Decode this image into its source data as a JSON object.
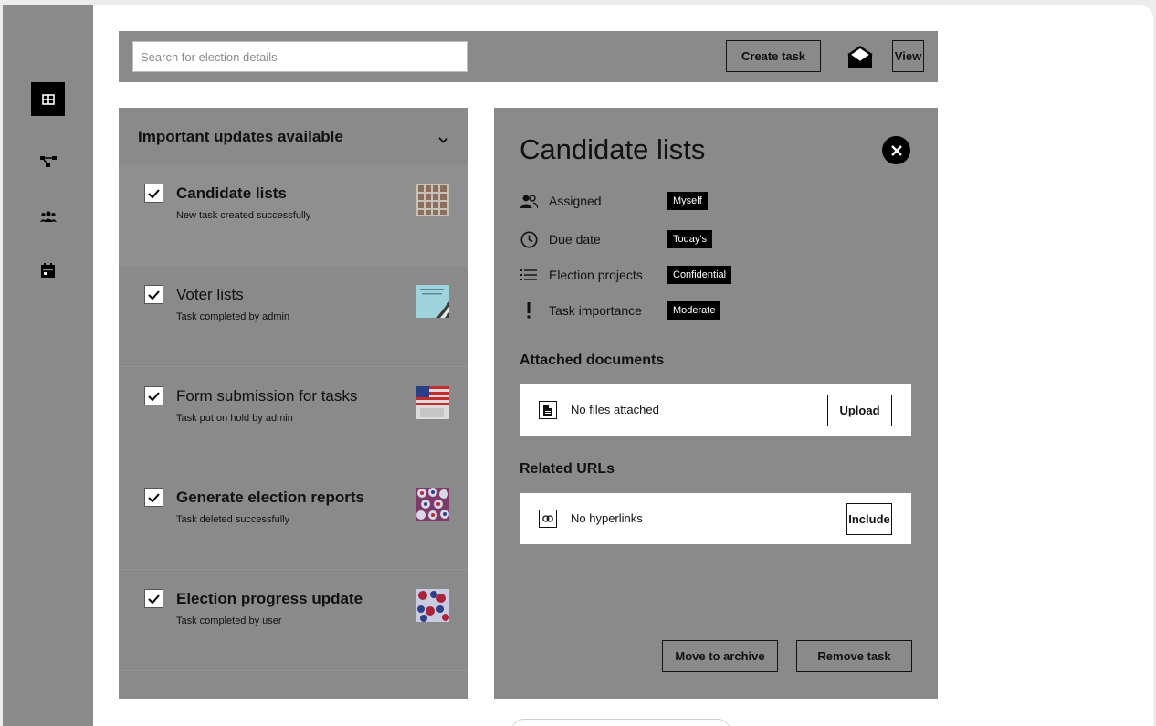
{
  "sidebar": {
    "items": [
      {
        "name": "dashboard",
        "icon": "grid-icon",
        "active": true
      },
      {
        "name": "workflow",
        "icon": "hierarchy-icon",
        "active": false
      },
      {
        "name": "team",
        "icon": "people-icon",
        "active": false
      },
      {
        "name": "calendar",
        "icon": "calendar-icon",
        "active": false
      }
    ]
  },
  "topbar": {
    "search_placeholder": "Search for election details",
    "create_label": "Create task",
    "mail_icon": "envelope-open-icon",
    "view_label": "View"
  },
  "task_panel": {
    "heading": "Important updates available",
    "tasks": [
      {
        "title": "Candidate lists",
        "status": "New task created successfully",
        "checked": true,
        "thumb": "ballot-photo"
      },
      {
        "title": "Voter lists",
        "status": "Task completed by admin",
        "checked": true,
        "thumb": "document-photo"
      },
      {
        "title": "Form submission for tasks",
        "status": "Task put on hold by admin",
        "checked": true,
        "thumb": "flag-photo"
      },
      {
        "title": "Generate election reports",
        "status": "Task deleted successfully",
        "checked": true,
        "thumb": "badges-photo"
      },
      {
        "title": "Election progress update",
        "status": "Task completed by user",
        "checked": true,
        "thumb": "buttons-photo"
      }
    ]
  },
  "detail": {
    "title": "Candidate lists",
    "properties": [
      {
        "label": "Assigned",
        "value": "Myself",
        "icon": "people-icon"
      },
      {
        "label": "Due date",
        "value": "Today's",
        "icon": "clock-icon"
      },
      {
        "label": "Election projects",
        "value": "Confidential",
        "icon": "list-icon"
      },
      {
        "label": "Task importance",
        "value": "Moderate",
        "icon": "exclamation-icon"
      }
    ],
    "documents": {
      "heading": "Attached documents",
      "empty_text": "No files attached",
      "button": "Upload"
    },
    "urls": {
      "heading": "Related URLs",
      "empty_text": "No hyperlinks",
      "button": "Include"
    },
    "archive_label": "Move to archive",
    "remove_label": "Remove task"
  }
}
